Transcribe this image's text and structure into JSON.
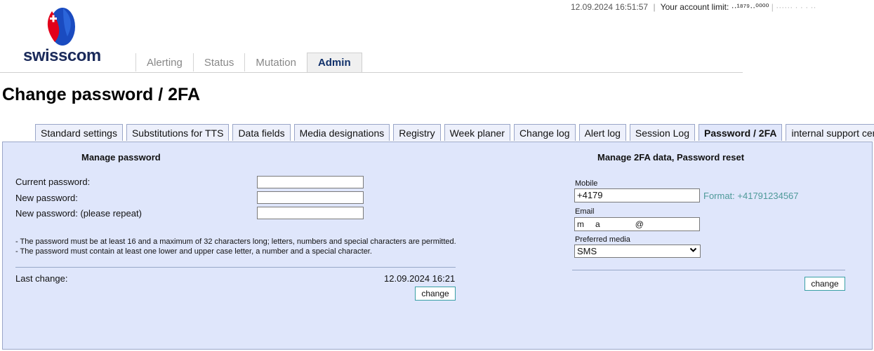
{
  "header": {
    "brand": "swisscom",
    "datetime": "12.09.2024 16:51:57",
    "separator": "|",
    "account_limit_label": "Your account limit:",
    "account_limit_value": "··¹⁸⁷⁹··⁰⁰⁰⁰",
    "account_trailing": "|  ······ ·   ·   ·   ··",
    "colors": {
      "brand_red": "#e2001a",
      "brand_blue": "#1a4bc0",
      "brand_text": "#1a2a5a"
    }
  },
  "main_tabs": [
    {
      "label": "Alerting",
      "active": false
    },
    {
      "label": "Status",
      "active": false
    },
    {
      "label": "Mutation",
      "active": false
    },
    {
      "label": "Admin",
      "active": true
    }
  ],
  "page_title": "Change password / 2FA",
  "sub_tabs": [
    {
      "label": "Standard settings",
      "active": false
    },
    {
      "label": "Substitutions for TTS",
      "active": false
    },
    {
      "label": "Data fields",
      "active": false
    },
    {
      "label": "Media designations",
      "active": false
    },
    {
      "label": "Registry",
      "active": false
    },
    {
      "label": "Week planer",
      "active": false
    },
    {
      "label": "Change log",
      "active": false
    },
    {
      "label": "Alert log",
      "active": false
    },
    {
      "label": "Session Log",
      "active": false
    },
    {
      "label": "Password / 2FA",
      "active": true
    },
    {
      "label": "internal support center",
      "active": false
    }
  ],
  "password": {
    "title": "Manage password",
    "current_label": "Current password:",
    "new_label": "New password:",
    "repeat_label": "New password: (please repeat)",
    "current_value": "",
    "new_value": "",
    "repeat_value": "",
    "rule1": "- The password must be at least 16 and a maximum of 32 characters long; letters, numbers and special characters are permitted.",
    "rule2": "- The password must contain at least one lower and upper case letter, a number and a special character.",
    "last_change_label": "Last change:",
    "last_change_value": "12.09.2024 16:21",
    "button": "change"
  },
  "twofa": {
    "title": "Manage 2FA data, Password reset",
    "mobile_label": "Mobile",
    "mobile_value": "+4179",
    "mobile_format": "Format: +41791234567",
    "email_label": "Email",
    "email_value_a": "m",
    "email_value_b": "a",
    "email_value_c": "@",
    "preferred_label": "Preferred media",
    "preferred_value": "SMS",
    "button": "change"
  }
}
